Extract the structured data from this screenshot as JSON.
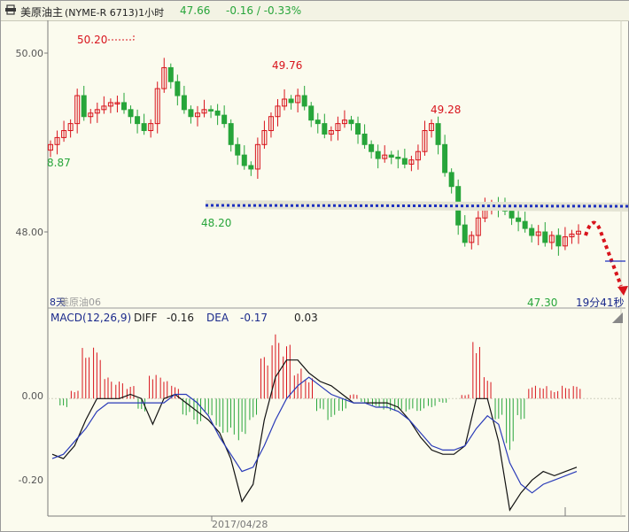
{
  "header": {
    "instrument": "美原油主",
    "code": "(NYME-R 6713)1小时",
    "last": "47.66",
    "change": "-0.16 / -0.33%",
    "colors": {
      "up": "#d8141c",
      "down": "#27a53a",
      "text": "#222222"
    }
  },
  "chart_data": [
    {
      "type": "candlestick",
      "title": "美原油主 (NYME-R 6713)1小时",
      "yticks": [
        "50.00",
        "48.00"
      ],
      "ylim": [
        46.65,
        50.55
      ],
      "annotations": {
        "high_label": "50.20",
        "left_label": "8.87",
        "peak_label_1": "49.76",
        "low_label_1": "48.20",
        "peak_label_2": "49.28",
        "low_label_2": "47.30",
        "bars_label": "8天",
        "watermark": "美原油06",
        "countdown": "19分41秒"
      },
      "support_line": {
        "value": 48.27,
        "color": "#1c2fbf"
      },
      "projection": {
        "color": "#d8141c"
      },
      "closes": [
        48.9,
        49.0,
        49.1,
        49.2,
        49.6,
        49.3,
        49.35,
        49.4,
        49.45,
        49.5,
        49.5,
        49.4,
        49.3,
        49.2,
        49.1,
        49.2,
        49.7,
        50.0,
        49.8,
        49.6,
        49.4,
        49.3,
        49.35,
        49.4,
        49.38,
        49.32,
        49.2,
        48.9,
        48.75,
        48.6,
        48.55,
        48.9,
        49.1,
        49.3,
        49.45,
        49.55,
        49.5,
        49.6,
        49.45,
        49.25,
        49.2,
        49.05,
        49.1,
        49.2,
        49.25,
        49.2,
        49.05,
        48.9,
        48.8,
        48.7,
        48.75,
        48.72,
        48.7,
        48.62,
        48.68,
        48.8,
        49.1,
        49.2,
        48.9,
        48.5,
        48.3,
        47.75,
        47.5,
        47.6,
        47.85,
        48.0,
        48.05,
        48.0,
        47.95,
        47.85,
        47.8,
        47.7,
        47.6,
        47.65,
        47.5,
        47.6,
        47.45,
        47.58,
        47.62,
        47.66
      ],
      "x_date_label": "2017/04/28"
    },
    {
      "type": "line",
      "title": "MACD(12,26,9)",
      "legend": [
        "DIFF",
        "DEA"
      ],
      "legend_values": [
        "-0.16",
        "-0.17",
        "0.03"
      ],
      "yticks": [
        "0.00",
        "-0.20"
      ],
      "ylim": [
        -0.27,
        0.17
      ],
      "series": [
        {
          "name": "DIFF",
          "color": "#111111",
          "values": [
            -0.13,
            -0.14,
            -0.11,
            -0.05,
            0.0,
            0.0,
            0.0,
            0.01,
            0.0,
            -0.06,
            0.0,
            0.01,
            -0.01,
            -0.03,
            -0.05,
            -0.08,
            -0.14,
            -0.24,
            -0.2,
            -0.05,
            0.05,
            0.09,
            0.09,
            0.06,
            0.04,
            0.03,
            0.01,
            -0.01,
            -0.01,
            -0.01,
            -0.01,
            -0.02,
            -0.05,
            -0.09,
            -0.12,
            -0.13,
            -0.13,
            -0.11,
            0.0,
            0.0,
            -0.1,
            -0.26,
            -0.22,
            -0.19,
            -0.17,
            -0.18,
            -0.17,
            -0.16
          ]
        },
        {
          "name": "DEA",
          "color": "#2a3bb8",
          "values": [
            -0.14,
            -0.13,
            -0.1,
            -0.07,
            -0.03,
            -0.01,
            -0.01,
            -0.01,
            -0.01,
            -0.01,
            -0.01,
            0.01,
            0.01,
            -0.01,
            -0.04,
            -0.09,
            -0.13,
            -0.17,
            -0.16,
            -0.11,
            -0.05,
            0.0,
            0.03,
            0.05,
            0.03,
            0.01,
            0.0,
            -0.01,
            -0.01,
            -0.02,
            -0.02,
            -0.03,
            -0.05,
            -0.08,
            -0.11,
            -0.12,
            -0.12,
            -0.11,
            -0.07,
            -0.04,
            -0.06,
            -0.15,
            -0.2,
            -0.22,
            -0.2,
            -0.19,
            -0.18,
            -0.17
          ]
        }
      ],
      "histogram": [
        0.0,
        -0.02,
        0.02,
        0.12,
        0.12,
        0.05,
        0.04,
        0.03,
        -0.03,
        0.06,
        0.05,
        0.03,
        -0.04,
        -0.06,
        -0.04,
        -0.08,
        -0.09,
        -0.1,
        -0.05,
        0.1,
        0.15,
        0.13,
        0.07,
        0.05,
        -0.03,
        -0.05,
        -0.03,
        0.01,
        -0.01,
        -0.02,
        -0.03,
        -0.03,
        -0.03,
        -0.03,
        -0.02,
        -0.01,
        0.0,
        0.01,
        0.14,
        0.05,
        -0.05,
        -0.12,
        -0.05,
        0.03,
        0.03,
        0.02,
        0.03,
        0.03
      ]
    }
  ]
}
